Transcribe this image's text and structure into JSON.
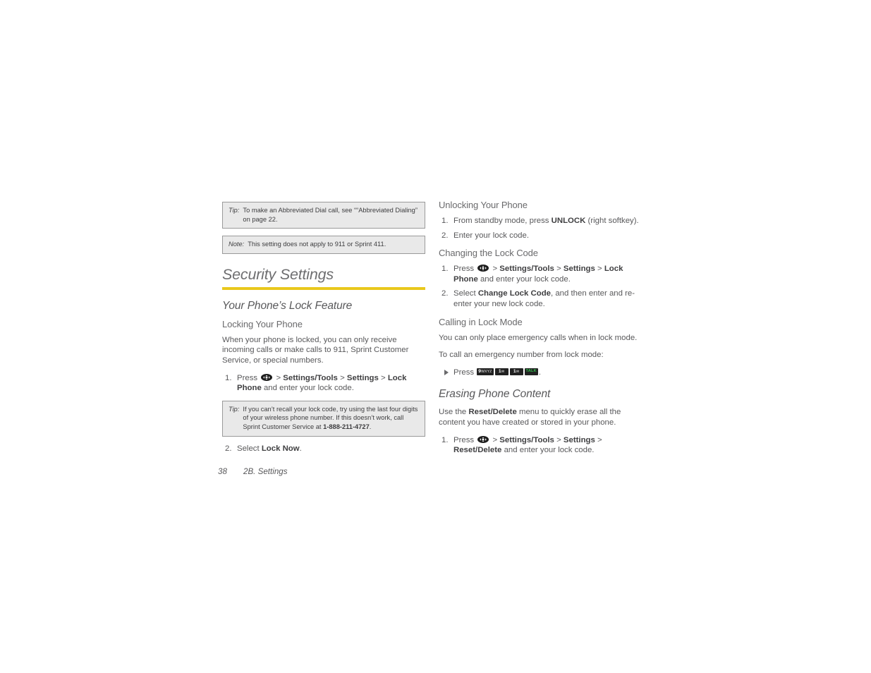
{
  "page": {
    "footer_page_number": "38",
    "footer_chapter": "2B. Settings",
    "accent_color": "#e9c81c",
    "callout_bg": "#e9e9e9",
    "callout_border": "#9a9a9a",
    "text_color": "#58585a",
    "talk_key_color": "#2fbf4a"
  },
  "left_column": {
    "tip_abbreviated": {
      "label": "Tip:",
      "text": "To make an Abbreviated Dial call, see ““Abbreviated Dialing” on page 22."
    },
    "note_911": {
      "label": "Note:",
      "text": "This setting does not apply to 911 or Sprint 411."
    },
    "section_heading": "Security Settings",
    "subsection_heading": "Your Phone’s Lock Feature",
    "locking_heading": "Locking Your Phone",
    "locking_intro": "When your phone is locked, you can only receive incoming calls or make calls to 911, Sprint Customer Service, or special numbers.",
    "locking_steps": [
      {
        "num": "1.",
        "parts": [
          {
            "t": "Press ",
            "b": false
          },
          {
            "t": "NAV_KEY",
            "b": false,
            "icon": "nav-key-icon"
          },
          {
            "t": " > ",
            "b": false
          },
          {
            "t": "Settings/Tools",
            "b": true
          },
          {
            "t": " > ",
            "b": false
          },
          {
            "t": "Settings",
            "b": true
          },
          {
            "t": " > ",
            "b": false
          },
          {
            "t": "Lock Phone",
            "b": true
          },
          {
            "t": " and enter your lock code.",
            "b": false
          }
        ]
      }
    ],
    "tip_lockcode": {
      "label": "Tip:",
      "text_before": "If you can’t recall your lock code, try using the last four digits of your wireless phone number. If this doesn’t work, call Sprint Customer Service at ",
      "phone": "1-888-211-4727",
      "text_after": "."
    },
    "locking_step2": {
      "num": "2.",
      "text_before": "Select ",
      "bold": "Lock Now",
      "text_after": "."
    }
  },
  "right_column": {
    "unlocking_heading": "Unlocking Your Phone",
    "unlocking_steps": [
      {
        "num": "1.",
        "text_before": "From standby mode, press ",
        "bold": "UNLOCK",
        "text_after": " (right softkey)."
      },
      {
        "num": "2.",
        "text_before": "Enter your lock code.",
        "bold": "",
        "text_after": ""
      }
    ],
    "changing_heading": "Changing the Lock Code",
    "changing_step1": {
      "num": "1.",
      "press_label": "Press ",
      "sep": " > ",
      "crumb1": "Settings/Tools",
      "crumb2": "Settings",
      "crumb3": "Lock Phone",
      "tail": " and enter your lock code."
    },
    "changing_step2": {
      "num": "2.",
      "text_before": "Select ",
      "bold": "Change Lock Code",
      "text_after": ", and then enter and re-enter your new lock code."
    },
    "calling_heading": "Calling in Lock Mode",
    "calling_intro": "You can only place emergency calls when in lock mode.",
    "calling_lead": "To call an emergency number from lock mode:",
    "calling_bullet": {
      "press_label": "Press ",
      "keys": [
        {
          "name": "key-9-icon",
          "digit": "9",
          "sub": "WXYZ"
        },
        {
          "name": "key-1-icon",
          "digit": "1",
          "sub": "✉"
        },
        {
          "name": "key-1-icon",
          "digit": "1",
          "sub": "✉"
        },
        {
          "name": "key-talk-icon",
          "digit": "TALK",
          "sub": ""
        }
      ],
      "tail": "."
    },
    "erasing_heading": "Erasing Phone Content",
    "erasing_intro_before": "Use the ",
    "erasing_intro_bold": "Reset/Delete",
    "erasing_intro_after": " menu to quickly erase all the content you have created or stored in your phone.",
    "erasing_step1": {
      "num": "1.",
      "press_label": "Press ",
      "sep": " > ",
      "crumb1": "Settings/Tools",
      "crumb2": "Settings",
      "crumb3": "Reset/",
      "crumb3b": "Delete",
      "tail": " and enter your lock code."
    }
  }
}
